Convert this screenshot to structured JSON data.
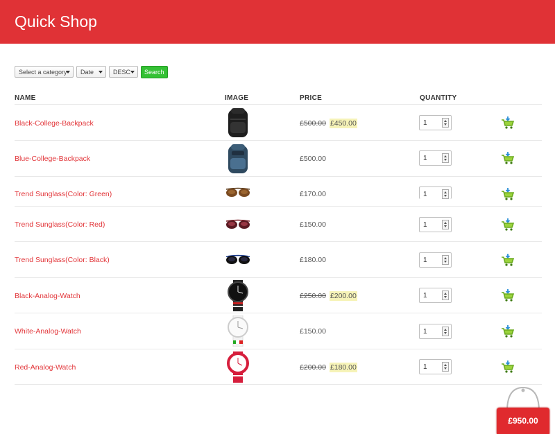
{
  "header": {
    "title": "Quick Shop"
  },
  "filters": {
    "category": "Select a category",
    "sort_by": "Date",
    "order": "DESC",
    "search_label": "Search"
  },
  "columns": {
    "name": "NAME",
    "image": "IMAGE",
    "price": "PRICE",
    "quantity": "QUANTITY"
  },
  "products": [
    {
      "name": "Black-College-Backpack",
      "old_price": "£500.00",
      "price": "£450.00",
      "qty": "1",
      "image": "black-backpack"
    },
    {
      "name": "Blue-College-Backpack",
      "price": "£500.00",
      "qty": "1",
      "image": "blue-backpack"
    },
    {
      "name": "Trend Sunglass(Color: Green)",
      "price": "£170.00",
      "qty": "1",
      "image": "sunglass-brown"
    },
    {
      "name": "Trend Sunglass(Color: Red)",
      "price": "£150.00",
      "qty": "1",
      "image": "sunglass-red"
    },
    {
      "name": "Trend Sunglass(Color: Black)",
      "price": "£180.00",
      "qty": "1",
      "image": "sunglass-black"
    },
    {
      "name": "Black-Analog-Watch",
      "old_price": "£250.00",
      "price": "£200.00",
      "qty": "1",
      "image": "watch-black"
    },
    {
      "name": "White-Analog-Watch",
      "price": "£150.00",
      "qty": "1",
      "image": "watch-white"
    },
    {
      "name": "Red-Analog-Watch",
      "old_price": "£200.00",
      "price": "£180.00",
      "qty": "1",
      "image": "watch-red"
    }
  ],
  "cart_total": "£950.00",
  "colors": {
    "brand": "#e03236",
    "link": "#e2363a",
    "search_button": "#35c135",
    "sale_highlight": "#f6f3b8"
  }
}
